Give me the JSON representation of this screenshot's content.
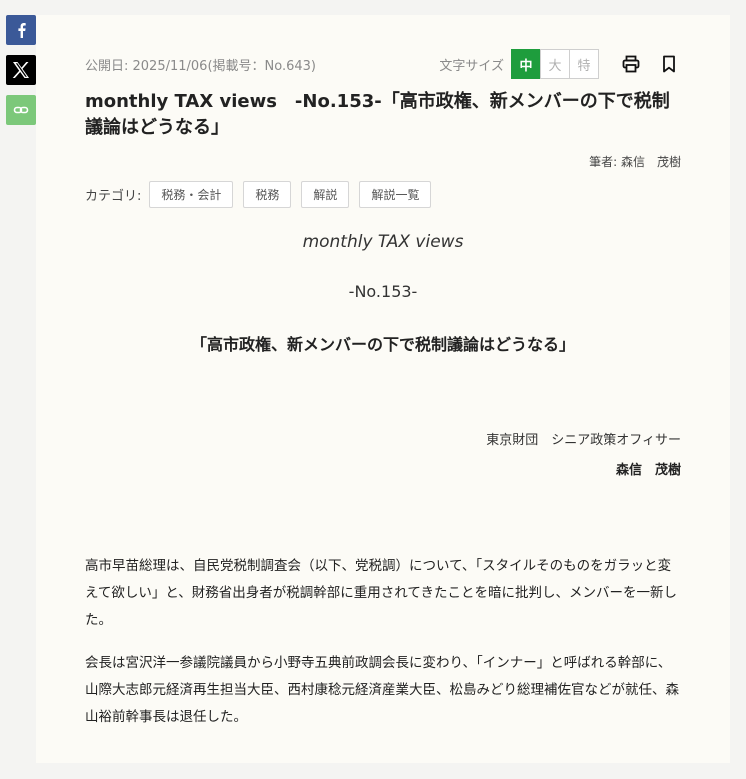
{
  "share": {
    "facebook_icon": "facebook-icon",
    "x_icon": "x-icon",
    "link_icon": "link-icon",
    "colors": {
      "facebook": "#3b5998",
      "x": "#000000",
      "link": "#7cc87a"
    }
  },
  "meta": {
    "published": "公開日: 2025/11/06",
    "issue": "(掲載号：No.643)"
  },
  "font_size": {
    "label": "文字サイズ",
    "options": [
      "中",
      "大",
      "特"
    ],
    "selected": "中",
    "accent": "#1e9d3d"
  },
  "tools": {
    "print_icon": "printer-icon",
    "bookmark_icon": "bookmark-icon"
  },
  "article": {
    "title": "monthly TAX views　-No.153-「高市政権、新メンバーの下で税制議論はどうなる」",
    "author_line": "筆者: 森信　茂樹",
    "category_label": "カテゴリ:",
    "categories": [
      "税務・会計",
      "税務",
      "解説",
      "解説一覧"
    ],
    "series": "monthly TAX views",
    "number": "-No.153-",
    "subtitle": "「高市政権、新メンバーの下で税制議論はどうなる」",
    "affiliation": "東京財団　シニア政策オフィサー",
    "author_name": "森信　茂樹",
    "paragraphs": [
      "高市早苗総理は、自民党税制調査会（以下、党税調）について、「スタイルそのものをガラッと変えて欲しい」と、財務省出身者が税調幹部に重用されてきたことを暗に批判し、メンバーを一新した。",
      "会長は宮沢洋一参議院議員から小野寺五典前政調会長に変わり、「インナー」と呼ばれる幹部に、山際大志郎元経済再生担当大臣、西村康稔元経済産業大臣、松島みどり総理補佐官などが就任、森山裕前幹事長は退任した。"
    ]
  }
}
